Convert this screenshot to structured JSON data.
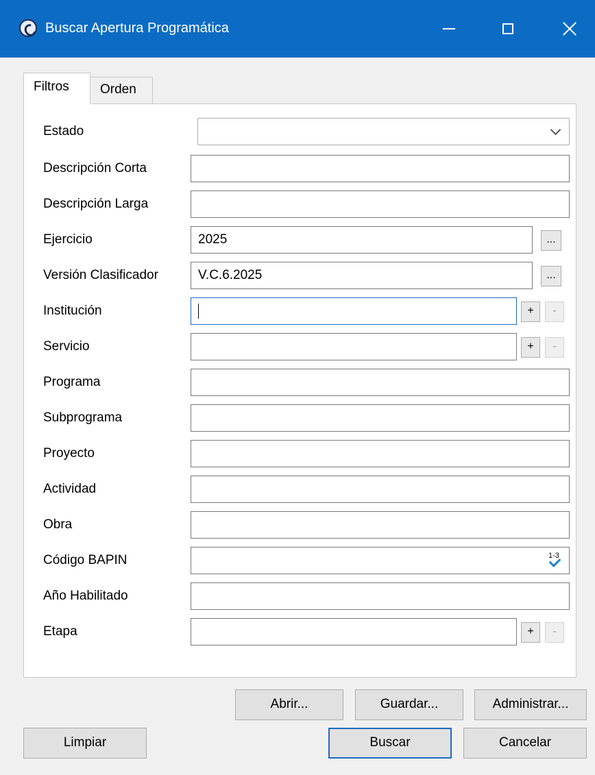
{
  "window": {
    "title": "Buscar Apertura Programática",
    "icon": "app-logo-icon",
    "controls": [
      "minimize-icon",
      "maximize-icon",
      "close-icon"
    ]
  },
  "tabs": [
    {
      "label": "Filtros",
      "active": true
    },
    {
      "label": "Orden",
      "active": false
    }
  ],
  "form": {
    "estado": {
      "label": "Estado",
      "value": ""
    },
    "descripcion_corta": {
      "label": "Descripción Corta",
      "value": ""
    },
    "descripcion_larga": {
      "label": "Descripción Larga",
      "value": ""
    },
    "ejercicio": {
      "label": "Ejercicio",
      "value": "2025",
      "browse": "..."
    },
    "version_clasificador": {
      "label": "Versión Clasificador",
      "value": "V.C.6.2025",
      "browse": "..."
    },
    "institucion": {
      "label": "Institución",
      "value": "",
      "add": "+",
      "remove": "-"
    },
    "servicio": {
      "label": "Servicio",
      "value": "",
      "add": "+",
      "remove": "-"
    },
    "programa": {
      "label": "Programa",
      "value": ""
    },
    "subprograma": {
      "label": "Subprograma",
      "value": ""
    },
    "proyecto": {
      "label": "Proyecto",
      "value": ""
    },
    "actividad": {
      "label": "Actividad",
      "value": ""
    },
    "obra": {
      "label": "Obra",
      "value": ""
    },
    "codigo_bapin": {
      "label": "Código BAPIN",
      "value": "",
      "icon_text": "1-3"
    },
    "anio_habilitado": {
      "label": "Año Habilitado",
      "value": ""
    },
    "etapa": {
      "label": "Etapa",
      "value": "",
      "add": "+",
      "remove": "-"
    }
  },
  "buttons": {
    "abrir": "Abrir...",
    "guardar": "Guardar...",
    "administrar": "Administrar...",
    "limpiar": "Limpiar",
    "buscar": "Buscar",
    "cancelar": "Cancelar"
  },
  "colors": {
    "titlebar": "#0c6cc4",
    "focus": "#1a6ac4",
    "window_bg": "#f0f0f0"
  }
}
